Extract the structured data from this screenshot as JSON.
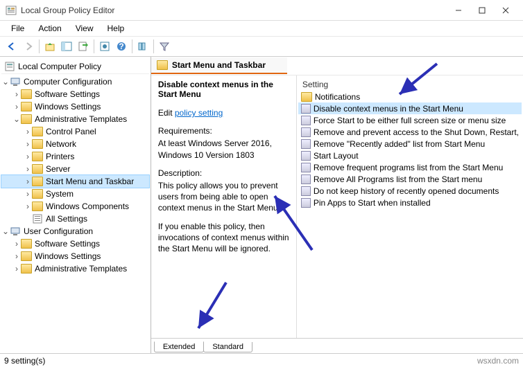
{
  "window": {
    "title": "Local Group Policy Editor"
  },
  "menubar": [
    "File",
    "Action",
    "View",
    "Help"
  ],
  "tree": {
    "root": "Local Computer Policy",
    "compConfig": "Computer Configuration",
    "compChildren": [
      "Software Settings",
      "Windows Settings"
    ],
    "adminTemplates": "Administrative Templates",
    "adminChildren": [
      "Control Panel",
      "Network",
      "Printers",
      "Server",
      "Start Menu and Taskbar",
      "System",
      "Windows Components",
      "All Settings"
    ],
    "selectedIndex": 4,
    "userConfig": "User Configuration",
    "userChildren": [
      "Software Settings",
      "Windows Settings",
      "Administrative Templates"
    ]
  },
  "breadcrumb": "Start Menu and Taskbar",
  "extended": {
    "title": "Disable context menus in the Start Menu",
    "editLabel": "Edit",
    "editLink": "policy setting",
    "reqLabel": "Requirements:",
    "reqText": "At least Windows Server 2016, Windows 10 Version 1803",
    "descLabel": "Description:",
    "descText": "This policy allows you to prevent users from being able to open context menus in the Start Menu.",
    "descText2": "If you enable this policy, then invocations of context menus within the Start Menu will be ignored."
  },
  "settings": {
    "header": "Setting",
    "items": [
      "Notifications",
      "Disable context menus in the Start Menu",
      "Force Start to be either full screen size or menu size",
      "Remove and prevent access to the Shut Down, Restart,",
      "Remove \"Recently added\" list from Start Menu",
      "Start Layout",
      "Remove frequent programs list from the Start Menu",
      "Remove All Programs list from the Start menu",
      "Do not keep history of recently opened documents",
      "Pin Apps to Start when installed"
    ],
    "selectedIndex": 1
  },
  "tabs": {
    "extended": "Extended",
    "standard": "Standard"
  },
  "statusbar": {
    "count": "9 setting(s)",
    "watermark": "wsxdn.com"
  }
}
